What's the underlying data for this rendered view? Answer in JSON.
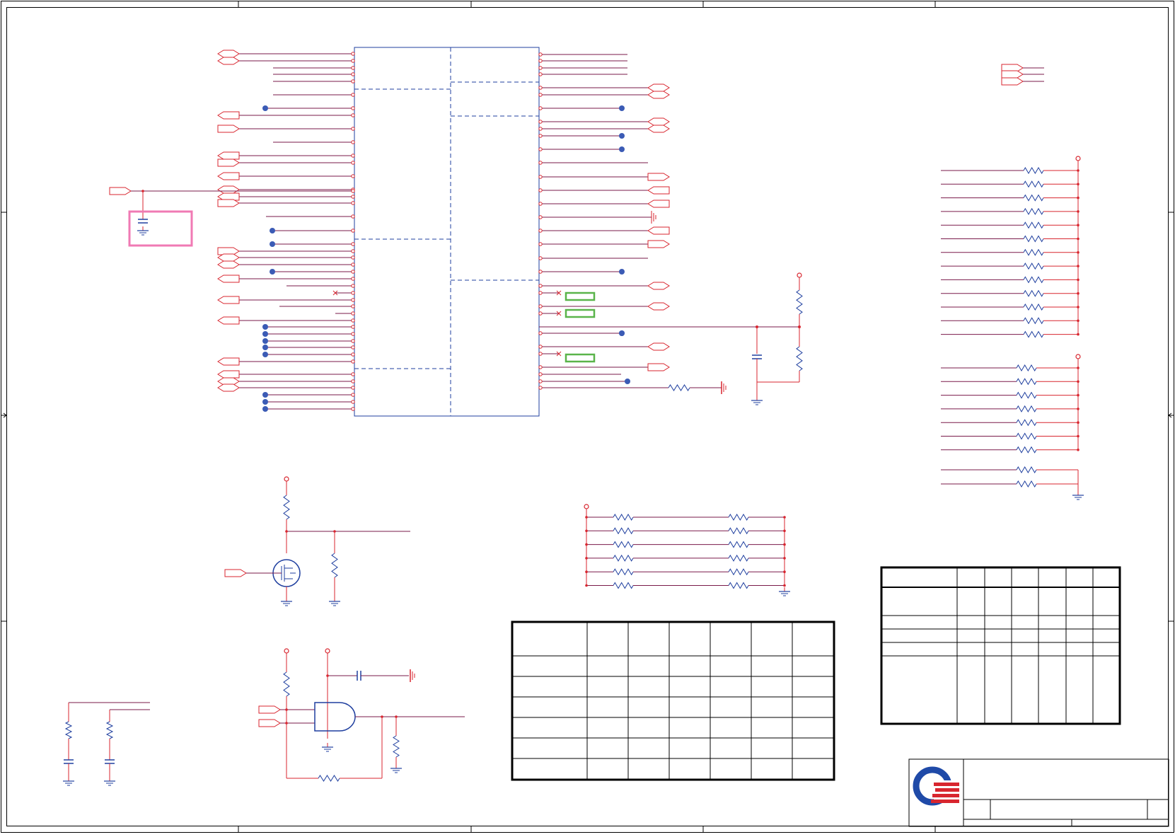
{
  "sheet": {
    "title": "",
    "border_color": "#000000",
    "wire_color": "#d8262f",
    "net_color": "#7a1a4a",
    "part_color": "#1f3f9f",
    "junction_color": "#3b5bb5",
    "highlight_pink": "#f07ab4",
    "highlight_green": "#5ab44a"
  },
  "logo": {
    "name": "q-logo-icon",
    "ring_color": "#1f4aa8",
    "bar_color": "#d8262f"
  },
  "tables": {
    "left_table": {
      "rows": 7,
      "cols": 7
    },
    "right_table": {
      "rows": 6,
      "cols": 7
    }
  },
  "title_block": {
    "fields": []
  }
}
